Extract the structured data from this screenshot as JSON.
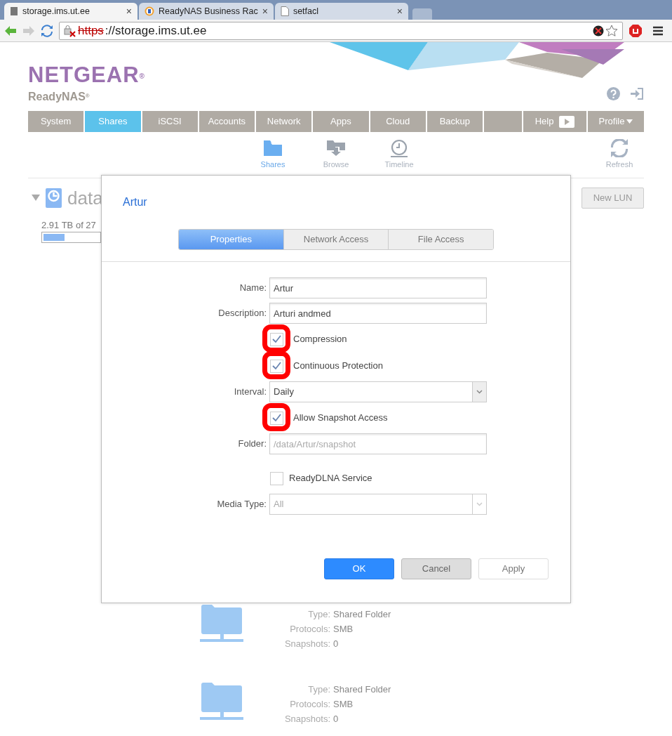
{
  "browser": {
    "tabs": [
      {
        "title": "storage.ims.ut.ee",
        "selected": true,
        "close": "×"
      },
      {
        "title": "ReadyNAS Business Rac",
        "selected": false,
        "close": "×"
      },
      {
        "title": "setfacl",
        "selected": false,
        "close": "×"
      }
    ],
    "address": {
      "scheme": "https",
      "rest": "://storage.ims.ut.ee",
      "insecure": true
    }
  },
  "header": {
    "logo": "NETGEAR$^{®}$",
    "product": "ReadyNAS$^{®}$"
  },
  "nav": [
    {
      "kind": "tab",
      "label": "System",
      "selected": false
    },
    {
      "kind": "tab",
      "label": "Shares",
      "selected": true
    },
    {
      "kind": "tab",
      "label": "iSCSI",
      "selected": false
    },
    {
      "kind": "tab",
      "label": "Accounts",
      "selected": false
    },
    {
      "kind": "tab",
      "label": "Network",
      "selected": false
    },
    {
      "kind": "tab",
      "label": "Apps",
      "selected": false
    },
    {
      "kind": "tab",
      "label": "Cloud",
      "selected": false
    },
    {
      "kind": "tab",
      "label": "Backup",
      "selected": false
    },
    {
      "kind": "blank",
      "selected": false
    },
    {
      "kind": "help",
      "label": "Help",
      "selected": false
    },
    {
      "kind": "profile",
      "label": "Profile",
      "selected": false
    }
  ],
  "subnav": [
    {
      "label": "Shares",
      "selected": true
    },
    {
      "label": "Browse",
      "selected": false
    },
    {
      "label": "Timeline",
      "selected": false
    }
  ],
  "refresh": "Refresh",
  "volume": {
    "name": "data",
    "usage": "2.91 TB of 27",
    "expanded": true
  },
  "new_lun": "New LUN",
  "shares": [
    {
      "fields": [
        {
          "label": "Type:",
          "value": "Shared Folder"
        },
        {
          "label": "Protocols:",
          "value": "SMB"
        },
        {
          "label": "Snapshots:",
          "value": "0"
        }
      ]
    },
    {
      "fields": [
        {
          "label": "Type:",
          "value": "Shared Folder"
        },
        {
          "label": "Protocols:",
          "value": "SMB"
        },
        {
          "label": "Snapshots:",
          "value": "0"
        }
      ]
    }
  ],
  "dialog": {
    "title": "Artur",
    "tabs": [
      {
        "label": "Properties",
        "selected": true
      },
      {
        "label": "Network Access",
        "selected": false
      },
      {
        "label": "File Access",
        "selected": false
      }
    ],
    "fields": [
      {
        "kind": "text",
        "label": "Name:",
        "value": "Artur",
        "disabled": false
      },
      {
        "kind": "text",
        "label": "Description:",
        "value": "Arturi andmed",
        "disabled": false
      },
      {
        "kind": "checkbox",
        "label": "Compression",
        "checked": true,
        "circled": true
      },
      {
        "kind": "checkbox",
        "label": "Continuous Protection",
        "checked": true,
        "circled": true
      },
      {
        "kind": "select",
        "label": "Interval:",
        "value": "Daily",
        "disabled": false
      },
      {
        "kind": "checkbox",
        "label": "Allow Snapshot Access",
        "checked": true,
        "circled": true
      },
      {
        "kind": "text",
        "label": "Folder:",
        "value": "/data/Artur/snapshot",
        "disabled": true
      },
      {
        "kind": "checkbox",
        "label": "ReadyDLNA Service",
        "checked": false,
        "circled": false
      },
      {
        "kind": "select",
        "label": "Media Type:",
        "value": "All",
        "disabled": true
      }
    ],
    "buttons": [
      {
        "label": "OK",
        "kind": "primary"
      },
      {
        "label": "Cancel",
        "kind": "secondary"
      },
      {
        "label": "Apply",
        "kind": "plain"
      }
    ]
  }
}
